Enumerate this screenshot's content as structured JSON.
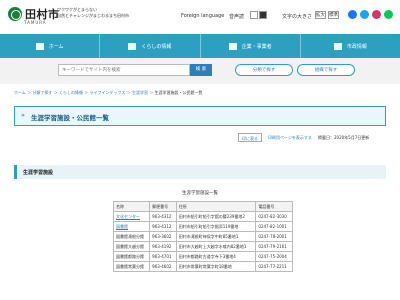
{
  "header": {
    "logo_text": "田村市",
    "logo_roman": "TAMURA",
    "tagline_1": "ワクワクがとまらない",
    "tagline_2": "自然とチャレンジがまじわるまち田村市",
    "foreign_language": "Foreign language",
    "voice_read": "音声読",
    "font_size_label": "文字の大きさ",
    "font_size_options": [
      "拡大",
      "標準"
    ]
  },
  "nav": {
    "items": [
      {
        "label": "ホーム"
      },
      {
        "label": "くらしの情報"
      },
      {
        "label": "企業・事業者"
      },
      {
        "label": "市政情報"
      }
    ]
  },
  "search": {
    "placeholder": "キーワードでサイト内を検索",
    "button": "検 索",
    "pill_1": "分類で探す",
    "pill_2": "組織で探す"
  },
  "breadcrumb": {
    "items": [
      "ホーム",
      "分類で探す",
      "くらしの情報",
      "ライフインデックス",
      "生涯学習",
      "生涯学習施設・公民館一覧"
    ]
  },
  "page_title": "生涯学習施設・公民館一覧",
  "tools": {
    "print_button": "印に表る",
    "print_preview": "印刷用ページを表示する",
    "date": "掲載日：2020年5月7日更新"
  },
  "section": {
    "heading": "生涯学習施設"
  },
  "table": {
    "caption": "生涯学習施設一覧",
    "headers": [
      "名称",
      "郵便番号",
      "住所",
      "電話番号"
    ],
    "rows": [
      [
        "文化センター",
        "963-4312",
        "田村市船引町船引字舘の腰239番地2",
        "0247-82-3030"
      ],
      [
        "図書館",
        "963-4312",
        "田村市船引町船引字畑添119番地",
        "0247-82-1001"
      ],
      [
        "図書館滝根分館",
        "963-3602",
        "田村市滝根町神俣字中町85番地1",
        "0247-78-2001"
      ],
      [
        "図書館大越分館",
        "963-4192",
        "田村市大越町上大越字水喰内82番地1",
        "0247-79-2161"
      ],
      [
        "図書館都路分館",
        "963-4701",
        "田村市都路町古道字寺下3番地4",
        "0247-75-2004"
      ],
      [
        "図書館常葉分館",
        "963-4602",
        "田村市常葉町常葉字町18番地",
        "0247-77-2211"
      ]
    ]
  }
}
